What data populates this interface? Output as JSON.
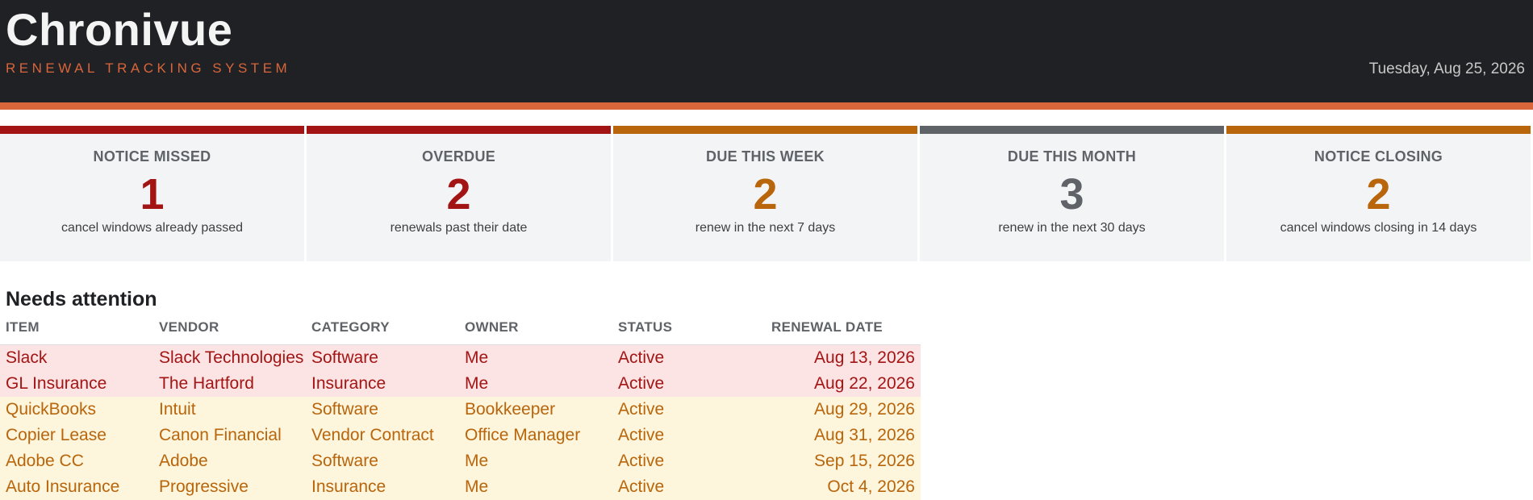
{
  "header": {
    "app_name": "Chronivue",
    "subtitle": "RENEWAL TRACKING SYSTEM",
    "date": "Tuesday, Aug 25, 2026"
  },
  "colors": {
    "header_bg": "#202124",
    "accent": "#d9653b",
    "danger": "#a31515",
    "warning": "#b8650c",
    "neutral": "#5f6368",
    "danger_row_bg": "#fce4e4",
    "warning_row_bg": "#fdf5dc"
  },
  "cards": [
    {
      "title": "NOTICE MISSED",
      "count": "1",
      "description": "cancel windows already passed",
      "tone": "danger"
    },
    {
      "title": "OVERDUE",
      "count": "2",
      "description": "renewals past their date",
      "tone": "danger"
    },
    {
      "title": "DUE THIS WEEK",
      "count": "2",
      "description": "renew in the next 7 days",
      "tone": "warning"
    },
    {
      "title": "DUE THIS MONTH",
      "count": "3",
      "description": "renew in the next 30 days",
      "tone": "neutral"
    },
    {
      "title": "NOTICE CLOSING",
      "count": "2",
      "description": "cancel windows closing in 14 days",
      "tone": "warning"
    }
  ],
  "attention": {
    "heading": "Needs attention",
    "columns": [
      "ITEM",
      "VENDOR",
      "CATEGORY",
      "OWNER",
      "STATUS",
      "RENEWAL DATE"
    ],
    "rows": [
      {
        "item": "Slack",
        "vendor": "Slack Technologies",
        "category": "Software",
        "owner": "Me",
        "status": "Active",
        "renewal_date": "Aug 13, 2026",
        "tone": "danger"
      },
      {
        "item": "GL Insurance",
        "vendor": "The Hartford",
        "category": "Insurance",
        "owner": "Me",
        "status": "Active",
        "renewal_date": "Aug 22, 2026",
        "tone": "danger"
      },
      {
        "item": "QuickBooks",
        "vendor": "Intuit",
        "category": "Software",
        "owner": "Bookkeeper",
        "status": "Active",
        "renewal_date": "Aug 29, 2026",
        "tone": "warning"
      },
      {
        "item": "Copier Lease",
        "vendor": "Canon Financial",
        "category": "Vendor Contract",
        "owner": "Office Manager",
        "status": "Active",
        "renewal_date": "Aug 31, 2026",
        "tone": "warning"
      },
      {
        "item": "Adobe CC",
        "vendor": "Adobe",
        "category": "Software",
        "owner": "Me",
        "status": "Active",
        "renewal_date": "Sep 15, 2026",
        "tone": "warning"
      },
      {
        "item": "Auto Insurance",
        "vendor": "Progressive",
        "category": "Insurance",
        "owner": "Me",
        "status": "Active",
        "renewal_date": "Oct 4, 2026",
        "tone": "warning"
      }
    ]
  }
}
